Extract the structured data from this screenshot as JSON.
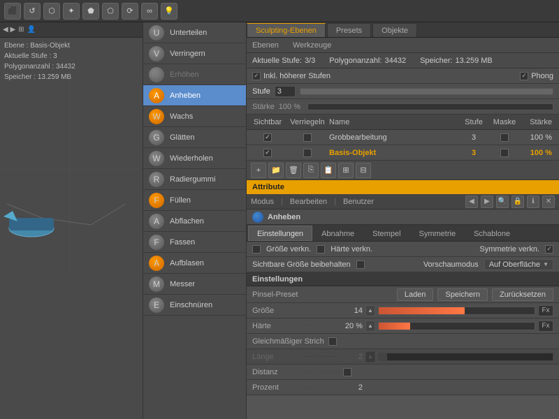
{
  "topbar": {
    "icons": [
      "▶",
      "⬛",
      "⬜",
      "⭕",
      "★",
      "☰",
      "⚙",
      "💡"
    ]
  },
  "tabs": {
    "main": [
      "Sculpting-Ebenen",
      "Presets",
      "Objekte"
    ],
    "sub": [
      "Ebenen",
      "Werkzeuge"
    ],
    "active_main": "Sculpting-Ebenen"
  },
  "status": {
    "aktuelle_stufe_label": "Aktuelle Stufe:",
    "aktuelle_stufe_value": "3/3",
    "polygonanzahl_label": "Polygonanzahl:",
    "polygonanzahl_value": "34432",
    "speicher_label": "Speicher:",
    "speicher_value": "13.259 MB"
  },
  "inkl_row": {
    "label": "Inkl. höherer Stufen",
    "phong_label": "Phong"
  },
  "stufe_row": {
    "label": "Stufe",
    "value": "3"
  },
  "starke_row": {
    "label": "Stärke",
    "value": "100 %"
  },
  "layers_header": {
    "sichtbar": "Sichtbar",
    "verriegeln": "Verriegeln",
    "name": "Name",
    "stufe": "Stufe",
    "maske": "Maske",
    "starke": "Stärke"
  },
  "layers": [
    {
      "checked": true,
      "locked": false,
      "name": "Grobbearbeitung",
      "stufe": "3",
      "maske": false,
      "starke": "100 %",
      "orange": false
    },
    {
      "checked": true,
      "locked": false,
      "name": "Basis-Objekt",
      "stufe": "3",
      "maske": false,
      "starke": "100 %",
      "orange": true
    }
  ],
  "attribute_label": "Attribute",
  "mode_bar": {
    "modus": "Modus",
    "bearbeiten": "Bearbeiten",
    "benutzer": "Benutzer"
  },
  "anheben_section": {
    "title": "Anheben"
  },
  "submode_tabs": [
    "Einstellungen",
    "Abnahme",
    "Stempel",
    "Symmetrie",
    "Schablone"
  ],
  "settings": {
    "grosse_verkn_label": "Größe verkn.",
    "harte_verkn_label": "Härte verkn.",
    "symmetrie_verkn_label": "Symmetrie verkn.",
    "sichtbare_grosse_label": "Sichtbare Größe beibehalten",
    "vorschaumodus_label": "Vorschaumodus",
    "vorschaumodus_value": "Auf Oberfläche"
  },
  "einstellungen": {
    "title": "Einstellungen",
    "pinsel_preset_label": "Pinsel-Preset",
    "laden_btn": "Laden",
    "speichern_btn": "Speichern",
    "zurucksetzen_btn": "Zurücksetzen"
  },
  "params": {
    "grosse_label": "Größe",
    "grosse_dots": "................",
    "grosse_value": "14",
    "harte_label": "Härte",
    "harte_dots": "................",
    "harte_value": "20 %",
    "gleich_label": "Gleichmäßiger Strich",
    "lange_label": "Länge",
    "lange_dots": "................",
    "lange_value": "2",
    "distanz_label": "Distanz",
    "distanz_dots": "................",
    "prozent_label": "Prozent",
    "prozent_value": "2"
  },
  "viewport_info": {
    "ebene_label": "Ebene",
    "ebene_value": "Basis-Objekt",
    "stufe_label": "Aktuelle Stufe",
    "stufe_value": "3",
    "poly_label": "Polygonanzahl",
    "poly_value": "34432",
    "speicher_label": "Speicher",
    "speicher_value": "13.259 MB"
  },
  "menu_items": [
    {
      "label": "Unterteilen",
      "icon_type": "gray",
      "active": false,
      "disabled": false
    },
    {
      "label": "Verringern",
      "icon_type": "gray",
      "active": false,
      "disabled": false
    },
    {
      "label": "Erhöhen",
      "icon_type": "gray",
      "active": false,
      "disabled": true
    },
    {
      "label": "Anheben",
      "icon_type": "orange",
      "active": true,
      "disabled": false
    },
    {
      "label": "Wachs",
      "icon_type": "orange",
      "active": false,
      "disabled": false
    },
    {
      "label": "Glätten",
      "icon_type": "gray",
      "active": false,
      "disabled": false
    },
    {
      "label": "Wiederholen",
      "icon_type": "gray",
      "active": false,
      "disabled": false
    },
    {
      "label": "Radiergummi",
      "icon_type": "gray",
      "active": false,
      "disabled": false
    },
    {
      "label": "Füllen",
      "icon_type": "orange",
      "active": false,
      "disabled": false
    },
    {
      "label": "Abflachen",
      "icon_type": "gray",
      "active": false,
      "disabled": false
    },
    {
      "label": "Fassen",
      "icon_type": "gray",
      "active": false,
      "disabled": false
    },
    {
      "label": "Aufblasen",
      "icon_type": "orange",
      "active": false,
      "disabled": false
    },
    {
      "label": "Messer",
      "icon_type": "gray",
      "active": false,
      "disabled": false
    },
    {
      "label": "Einschnüren",
      "icon_type": "gray",
      "active": false,
      "disabled": false
    }
  ]
}
